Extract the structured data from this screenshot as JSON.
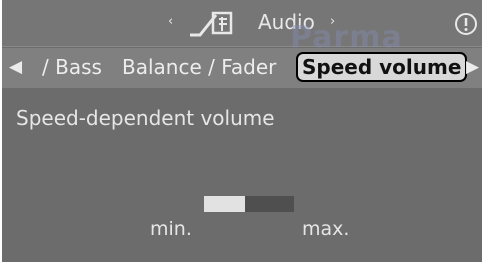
{
  "header": {
    "title": "Audio",
    "left_arrow": "‹",
    "right_arrow": "›",
    "audio_icon": "tone-settings-icon",
    "info_icon": "info-icon",
    "watermark": "Parma"
  },
  "tabs": {
    "left_arrow": "◀",
    "right_arrow": "▶",
    "items": [
      {
        "label": "/ Bass"
      },
      {
        "label": "Balance / Fader"
      },
      {
        "label": "Speed volume",
        "selected": true
      }
    ]
  },
  "content": {
    "section_label": "Speed-dependent volume",
    "slider": {
      "level": 0.45,
      "min_label": "min.",
      "max_label": "max."
    }
  },
  "colors": {
    "background": "#6c6c6c",
    "text": "#e6e6e6",
    "selected_tab_bg": "#d8d8d8",
    "slider_fill": "#e2e2e2",
    "slider_track": "#4f4f4f"
  }
}
